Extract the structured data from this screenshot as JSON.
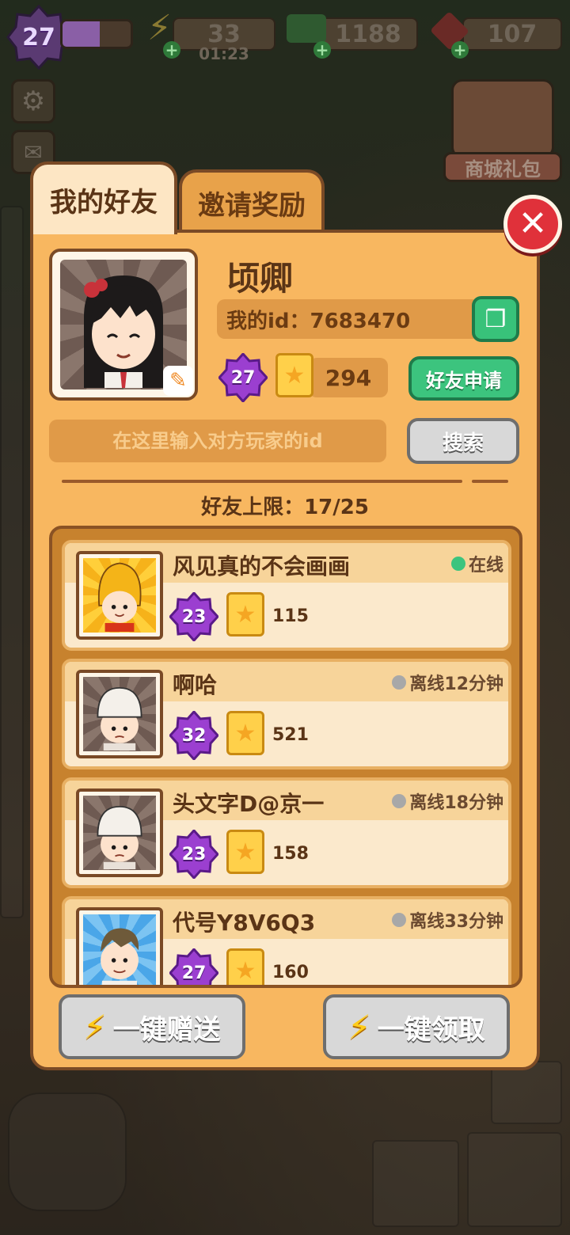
{
  "top_bar": {
    "player_level": "27",
    "xp_progress": 0.55,
    "energy": "33",
    "energy_timer": "01:23",
    "cash": "1188",
    "gems": "107"
  },
  "shop": {
    "label": "商城礼包"
  },
  "tabs": {
    "friends": "我的好友",
    "invite": "邀请奖励"
  },
  "profile": {
    "name": "顷卿",
    "id_label": "我的id：7683470",
    "level": "27",
    "stars": "294",
    "friend_request": "好友申请"
  },
  "search": {
    "placeholder": "在这里输入对方玩家的id",
    "button": "搜索"
  },
  "friend_limit": "好友上限：17/25",
  "friends": [
    {
      "name": "风见真的不会画画",
      "status": "在线",
      "online": true,
      "level": "23",
      "stars": "115"
    },
    {
      "name": "啊哈",
      "status": "离线12分钟",
      "online": false,
      "level": "32",
      "stars": "521"
    },
    {
      "name": "头文字D@京一",
      "status": "离线18分钟",
      "online": false,
      "level": "23",
      "stars": "158"
    },
    {
      "name": "代号Y8V6Q3",
      "status": "离线33分钟",
      "online": false,
      "level": "27",
      "stars": "160"
    }
  ],
  "actions": {
    "send_all": "一键赠送",
    "claim_all": "一键领取"
  },
  "colors": {
    "panel": "#f8b760",
    "online": "#3cc47e",
    "offline": "#a8a8a8",
    "close": "#e0313a",
    "level_badge": "#9b3fd0"
  },
  "icons": [
    "settings-gear-icon",
    "mail-icon",
    "lightning-icon",
    "cash-icon",
    "gem-icon",
    "close-icon",
    "copy-icon",
    "pencil-icon",
    "star-card-icon",
    "level-badge-icon"
  ]
}
